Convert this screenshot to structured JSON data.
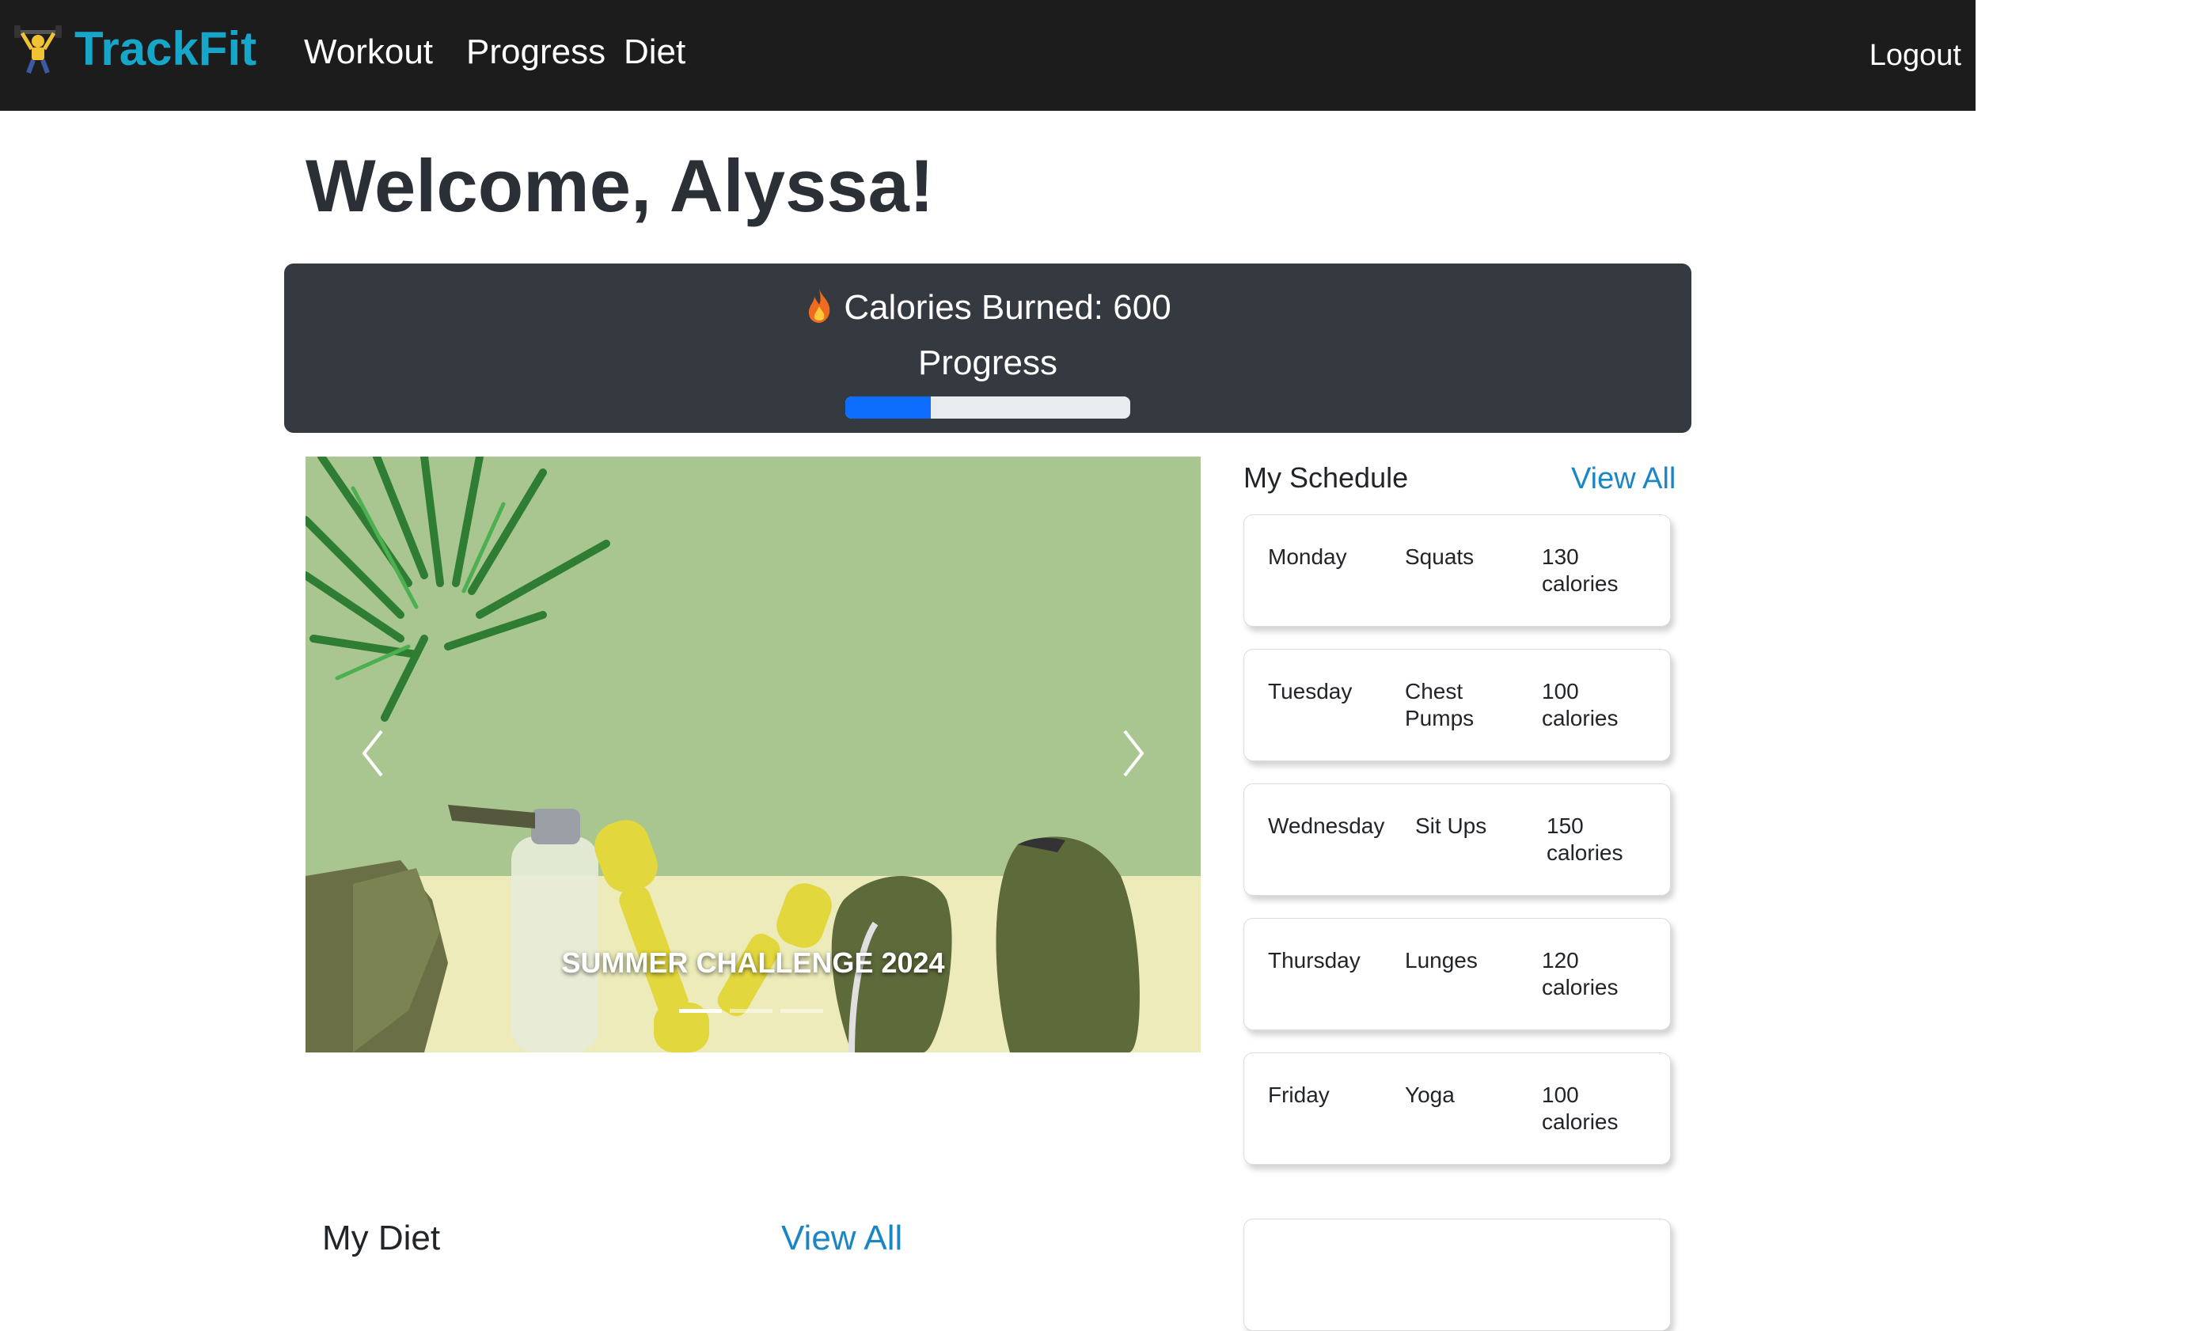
{
  "nav": {
    "brand": "TrackFit",
    "brand_icon": "weightlifter-icon",
    "links": [
      "Workout",
      "Progress",
      "Diet"
    ],
    "logout": "Logout"
  },
  "welcome": "Welcome, Alyssa!",
  "calories": {
    "text": "Calories Burned: 600",
    "icon": "fire-icon",
    "progress_label": "Progress",
    "progress_percent": 30
  },
  "carousel": {
    "caption": "SUMMER CHALLENGE 2024",
    "slide_count": 3,
    "active_slide": 0
  },
  "schedule": {
    "title": "My Schedule",
    "view_all": "View All",
    "items": [
      {
        "day": "Monday",
        "exercise": "Squats",
        "calories": "130 calories"
      },
      {
        "day": "Tuesday",
        "exercise": "Chest Pumps",
        "calories": "100 calories"
      },
      {
        "day": "Wednesday",
        "exercise": "Sit Ups",
        "calories": "150 calories"
      },
      {
        "day": "Thursday",
        "exercise": "Lunges",
        "calories": "120 calories"
      },
      {
        "day": "Friday",
        "exercise": "Yoga",
        "calories": "100 calories"
      }
    ]
  },
  "diet": {
    "title": "My Diet",
    "view_all": "View All"
  },
  "colors": {
    "navbar": "#1c1c1c",
    "brand": "#16a6c9",
    "banner": "#343a40",
    "progress": "#0d6efd",
    "link": "#1a86c4"
  }
}
